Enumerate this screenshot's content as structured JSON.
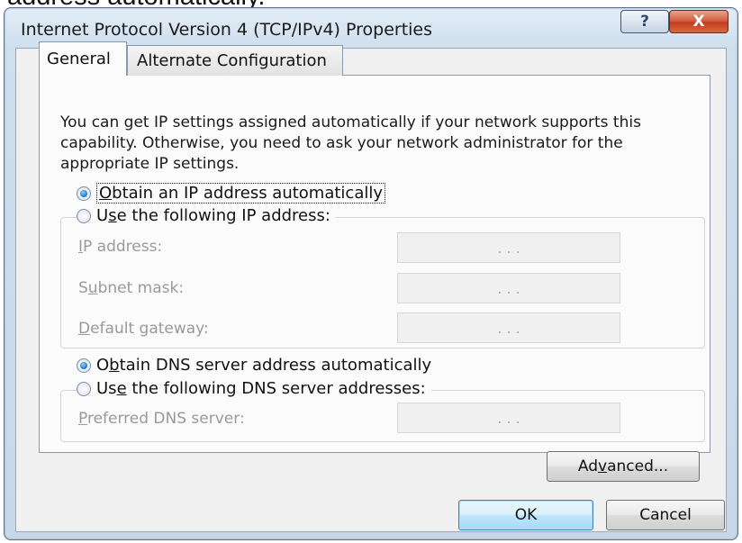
{
  "caption": {
    "text": "address automatically."
  },
  "window": {
    "title": "Internet Protocol Version 4 (TCP/IPv4) Properties",
    "help_label": "?",
    "close_label": "X"
  },
  "tabs": [
    {
      "label": "General",
      "selected": true
    },
    {
      "label": "Alternate Configuration",
      "selected": false
    }
  ],
  "intro_text": "You can get IP settings assigned automatically if your network supports this capability. Otherwise, you need to ask your network administrator for the appropriate IP settings.",
  "ip_mode": {
    "auto": {
      "pre": "",
      "mnemonic": "O",
      "post": "btain an IP address automatically",
      "selected": true
    },
    "manual": {
      "pre": "U",
      "mnemonic": "s",
      "post": "e the following IP address:",
      "selected": false
    }
  },
  "ip_fields": [
    {
      "pre": "",
      "mnemonic": "I",
      "post": "P address:",
      "value": ".  .  ."
    },
    {
      "pre": "S",
      "mnemonic": "u",
      "post": "bnet mask:",
      "value": ".  .  ."
    },
    {
      "pre": "",
      "mnemonic": "D",
      "post": "efault gateway:",
      "value": ".  .  ."
    }
  ],
  "dns_mode": {
    "auto": {
      "pre": "O",
      "mnemonic": "b",
      "post": "tain DNS server address automatically",
      "selected": true
    },
    "manual": {
      "pre": "Us",
      "mnemonic": "e",
      "post": " the following DNS server addresses:",
      "selected": false
    }
  },
  "dns_fields": [
    {
      "pre": "",
      "mnemonic": "P",
      "post": "referred DNS server:",
      "value": ".  .  ."
    }
  ],
  "buttons": {
    "advanced": {
      "pre": "Ad",
      "mnemonic": "v",
      "post": "anced..."
    },
    "ok": "OK",
    "cancel": "Cancel"
  }
}
